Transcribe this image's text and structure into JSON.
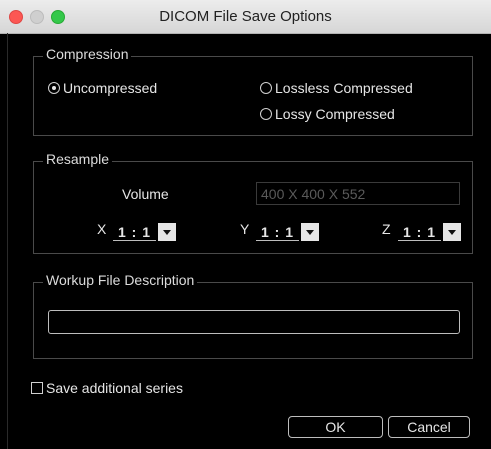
{
  "window": {
    "title": "DICOM File Save Options"
  },
  "compression": {
    "legend": "Compression",
    "options": [
      {
        "label": "Uncompressed",
        "checked": true
      },
      {
        "label": "Lossless Compressed",
        "checked": false
      },
      {
        "label": "Lossy Compressed",
        "checked": false
      }
    ]
  },
  "resample": {
    "legend": "Resample",
    "volume_label": "Volume",
    "volume_value": "400 X 400 X 552",
    "axes": [
      {
        "label": "X",
        "value": "1:1"
      },
      {
        "label": "Y",
        "value": "1:1"
      },
      {
        "label": "Z",
        "value": "1:1"
      }
    ]
  },
  "workup": {
    "legend": "Workup File Description",
    "value": ""
  },
  "save_additional": {
    "label": "Save additional series",
    "checked": false
  },
  "buttons": {
    "ok": "OK",
    "cancel": "Cancel"
  },
  "colors": {
    "close": "#fc5753",
    "minimize": "#cfcfcf",
    "maximize": "#34c84a",
    "background": "#000000"
  }
}
